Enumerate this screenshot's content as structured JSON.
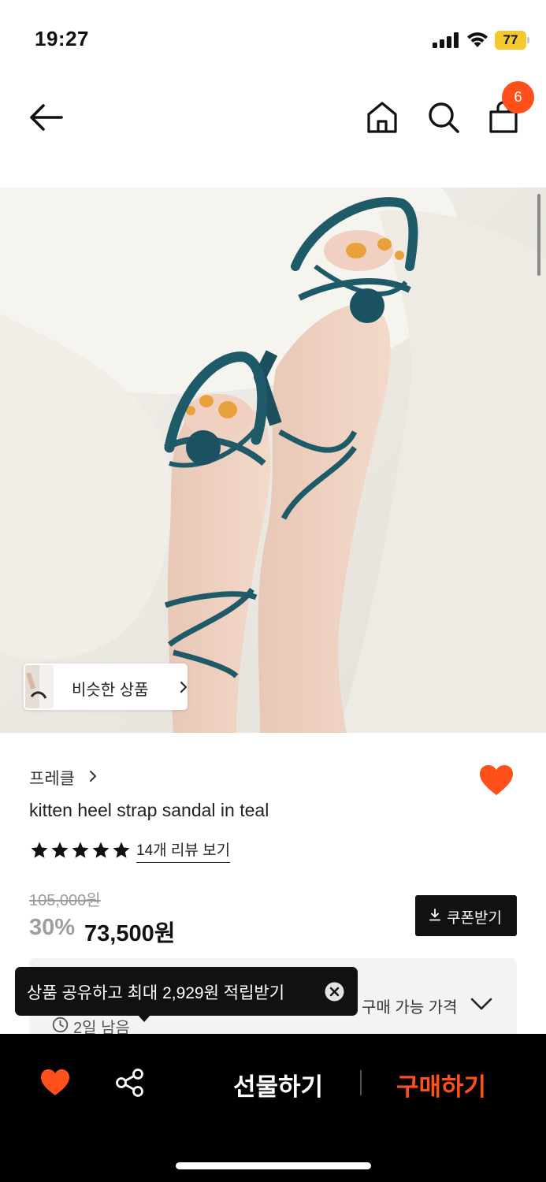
{
  "status_bar": {
    "time": "19:27",
    "battery": "77"
  },
  "header": {
    "cart_count": "6"
  },
  "gallery": {
    "similar_label": "비슷한 상품"
  },
  "product": {
    "brand": "프레클",
    "title": "kitten heel strap sandal in teal",
    "rating_stars": 5,
    "review_link": "14개 리뷰 보기",
    "original_price": "105,000원",
    "discount": "30%",
    "price": "73,500원"
  },
  "coupon": {
    "label": "쿠폰받기"
  },
  "price_box": {
    "label": "구매 가능 가격",
    "time_left": "2일 남음"
  },
  "tooltip": {
    "text": "상품 공유하고 최대 2,929원 적립받기"
  },
  "bottom_bar": {
    "gift_label": "선물하기",
    "buy_label": "구매하기"
  },
  "colors": {
    "accent": "#ff4f1a",
    "dark": "#111111",
    "teal": "#1f5a68"
  }
}
